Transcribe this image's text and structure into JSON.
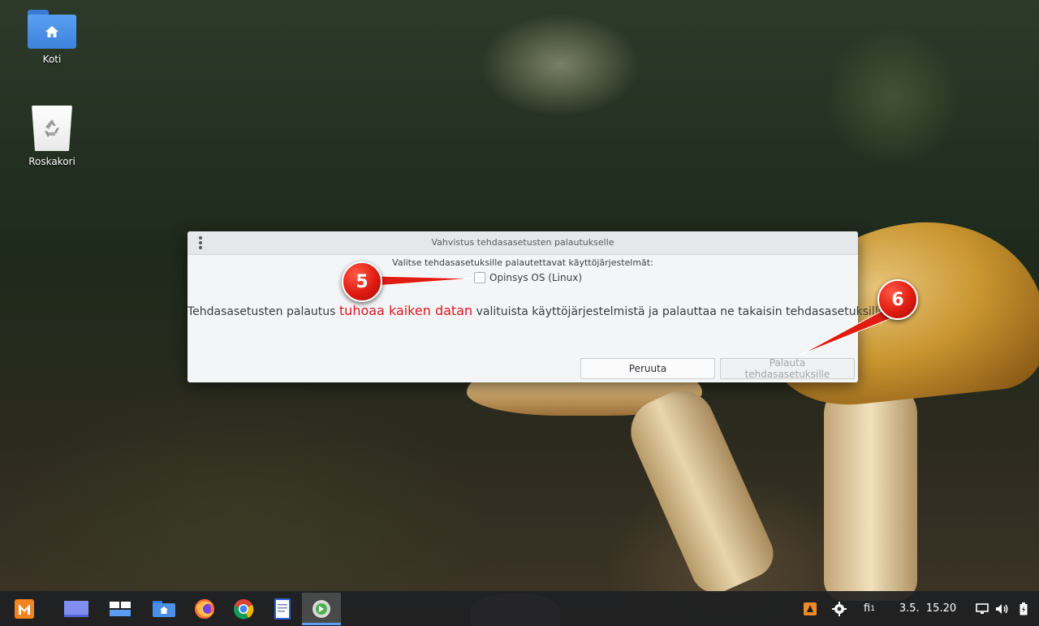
{
  "desktop": {
    "icons": [
      {
        "label": "Koti",
        "icon": "home-folder-icon"
      },
      {
        "label": "Roskakori",
        "icon": "trash-icon"
      }
    ]
  },
  "dialog": {
    "title": "Vahvistus tehdasasetusten palautukselle",
    "subtitle": "Valitse tehdasasetuksille palautettavat käyttöjärjestelmät:",
    "os_option": {
      "label": "Opinsys OS (Linux)",
      "checked": false
    },
    "warning_prefix": "Tehdasasetusten palautus ",
    "warning_emphasis": "tuhoaa kaiken datan",
    "warning_suffix": " valituista käyttöjärjestelmistä ja palauttaa ne takaisin tehdasasetuksille!",
    "cancel_label": "Peruuta",
    "reset_label": "Palauta tehdasasetuksille",
    "reset_enabled": false
  },
  "annotations": [
    {
      "number": "5"
    },
    {
      "number": "6"
    }
  ],
  "taskbar": {
    "apps": [
      {
        "icon": "menu-logo-icon"
      },
      {
        "icon": "workspace-icon"
      },
      {
        "icon": "window-switcher-icon"
      },
      {
        "icon": "file-manager-icon"
      },
      {
        "icon": "firefox-icon"
      },
      {
        "icon": "chrome-icon"
      },
      {
        "icon": "document-icon"
      },
      {
        "icon": "recovery-app-icon",
        "active": true
      }
    ],
    "tray": {
      "keyboard_layout": "fi",
      "keyboard_layout_sub": "1",
      "clock": "3.5.  15.20"
    }
  },
  "colors": {
    "danger": "#e0161b",
    "badge": "#e01b10",
    "accent": "#5b9cf5"
  }
}
